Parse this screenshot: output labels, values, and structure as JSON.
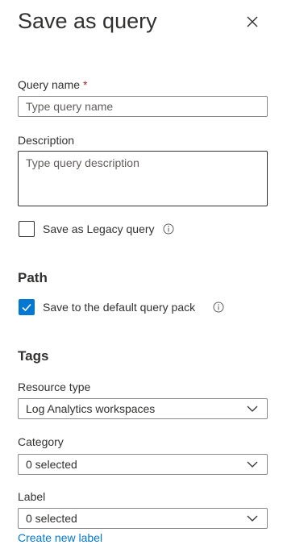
{
  "panel": {
    "title": "Save as query",
    "close_icon": "close-icon"
  },
  "query_name": {
    "label": "Query name",
    "required_marker": "*",
    "placeholder": "Type query name",
    "value": ""
  },
  "description": {
    "label": "Description",
    "placeholder": "Type query description",
    "value": ""
  },
  "legacy": {
    "label": "Save as Legacy query",
    "checked": false,
    "info_icon": "info-icon"
  },
  "path": {
    "heading": "Path",
    "default_pack_label": "Save to the default query pack",
    "checked": true,
    "info_icon": "info-icon"
  },
  "tags": {
    "heading": "Tags",
    "resource_type": {
      "label": "Resource type",
      "value": "Log Analytics workspaces"
    },
    "category": {
      "label": "Category",
      "value": "0 selected"
    },
    "label_field": {
      "label": "Label",
      "value": "0 selected"
    },
    "create_label_link": "Create new label"
  },
  "colors": {
    "accent": "#0078d4",
    "text": "#323130",
    "required": "#a4262c",
    "border": "#8a8886"
  }
}
